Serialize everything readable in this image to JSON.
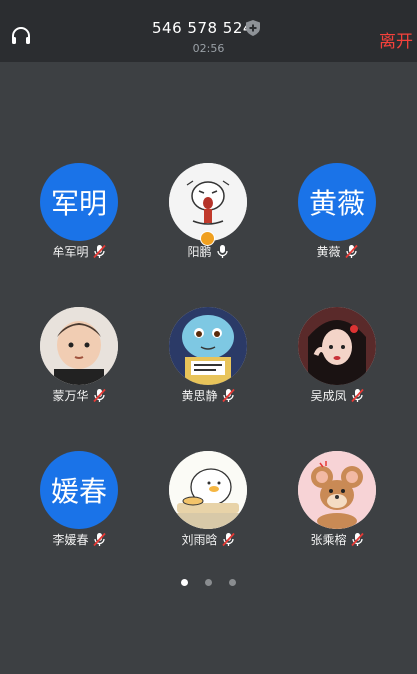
{
  "header": {
    "meeting_id": "546 578 524",
    "timer": "02:56",
    "leave_label": "离开"
  },
  "participants": [
    {
      "name": "牟军明",
      "avatar_text": "军明",
      "mic": "muted"
    },
    {
      "name": "阳鹏",
      "avatar_text": "",
      "mic": "on",
      "host": true
    },
    {
      "name": "黄薇",
      "avatar_text": "黄薇",
      "mic": "muted"
    },
    {
      "name": "蒙万华",
      "avatar_text": "",
      "mic": "muted"
    },
    {
      "name": "黄思静",
      "avatar_text": "",
      "mic": "muted"
    },
    {
      "name": "吴成凤",
      "avatar_text": "",
      "mic": "muted"
    },
    {
      "name": "李媛春",
      "avatar_text": "媛春",
      "mic": "muted"
    },
    {
      "name": "刘雨晗",
      "avatar_text": "",
      "mic": "muted"
    },
    {
      "name": "张乘榕",
      "avatar_text": "",
      "mic": "muted"
    }
  ],
  "pagination": {
    "pages": 3,
    "current": 1
  },
  "colors": {
    "avatar_blue": "#1a73e8",
    "leave_red": "#f5413b",
    "mute_red": "#e53935"
  }
}
